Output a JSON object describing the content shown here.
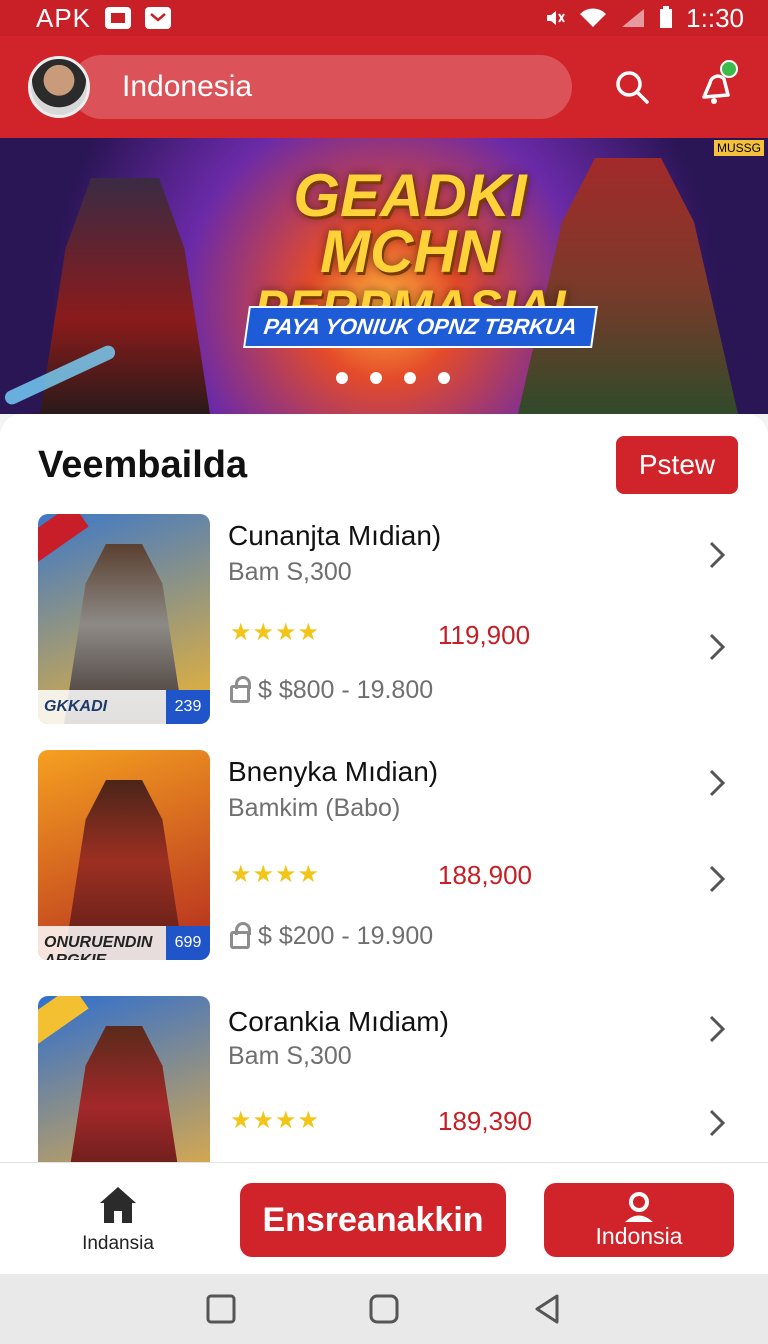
{
  "status_bar": {
    "carrier": "APK",
    "time": "1::30"
  },
  "header": {
    "search_text": "Indonesia"
  },
  "banner": {
    "title_line1": "GEADKI MCHN",
    "title_line2": "PERPMASIAI",
    "tagline": "PAYA YONIUK OPNZ TBRKUA",
    "corner_badge": "MUSSG",
    "dots": 4
  },
  "section": {
    "heading": "Veembailda",
    "action_label": "Pstew"
  },
  "items": [
    {
      "title": "Cunanjta Mıdian)",
      "subtitle": "Bam S,300",
      "rating_stars": "★★★★",
      "price": "119,900",
      "price_range": "$ $800 - 19.800",
      "thumb_caption": "GKKADI",
      "thumb_number": "239",
      "thumb_color_top": "#3d78c9",
      "thumb_color_bottom": "#f0b532"
    },
    {
      "title": "Bnenyka Mıdian)",
      "subtitle": "Bamkim (Babo)",
      "rating_stars": "★★★★",
      "price": "188,900",
      "price_range": "$ $200 - 19.900",
      "thumb_caption": "ONURUENDIN ARGKIE",
      "thumb_number": "699",
      "thumb_color_top": "#f5a020",
      "thumb_color_bottom": "#b32a20"
    },
    {
      "title": "Corankia Mıdiam)",
      "subtitle": "Bam S,300",
      "rating_stars": "★★★★",
      "price": "189,390",
      "price_range": "",
      "thumb_caption": "",
      "thumb_number": "",
      "thumb_color_top": "#2f6fd0",
      "thumb_color_bottom": "#f2b23a"
    }
  ],
  "bottom_nav": {
    "home_label": "Indansia",
    "main_button": "Ensreanakkin",
    "profile_label": "Indonsia"
  },
  "colors": {
    "brand_red": "#d1232a",
    "star": "#f2c518",
    "price": "#c51f26"
  }
}
